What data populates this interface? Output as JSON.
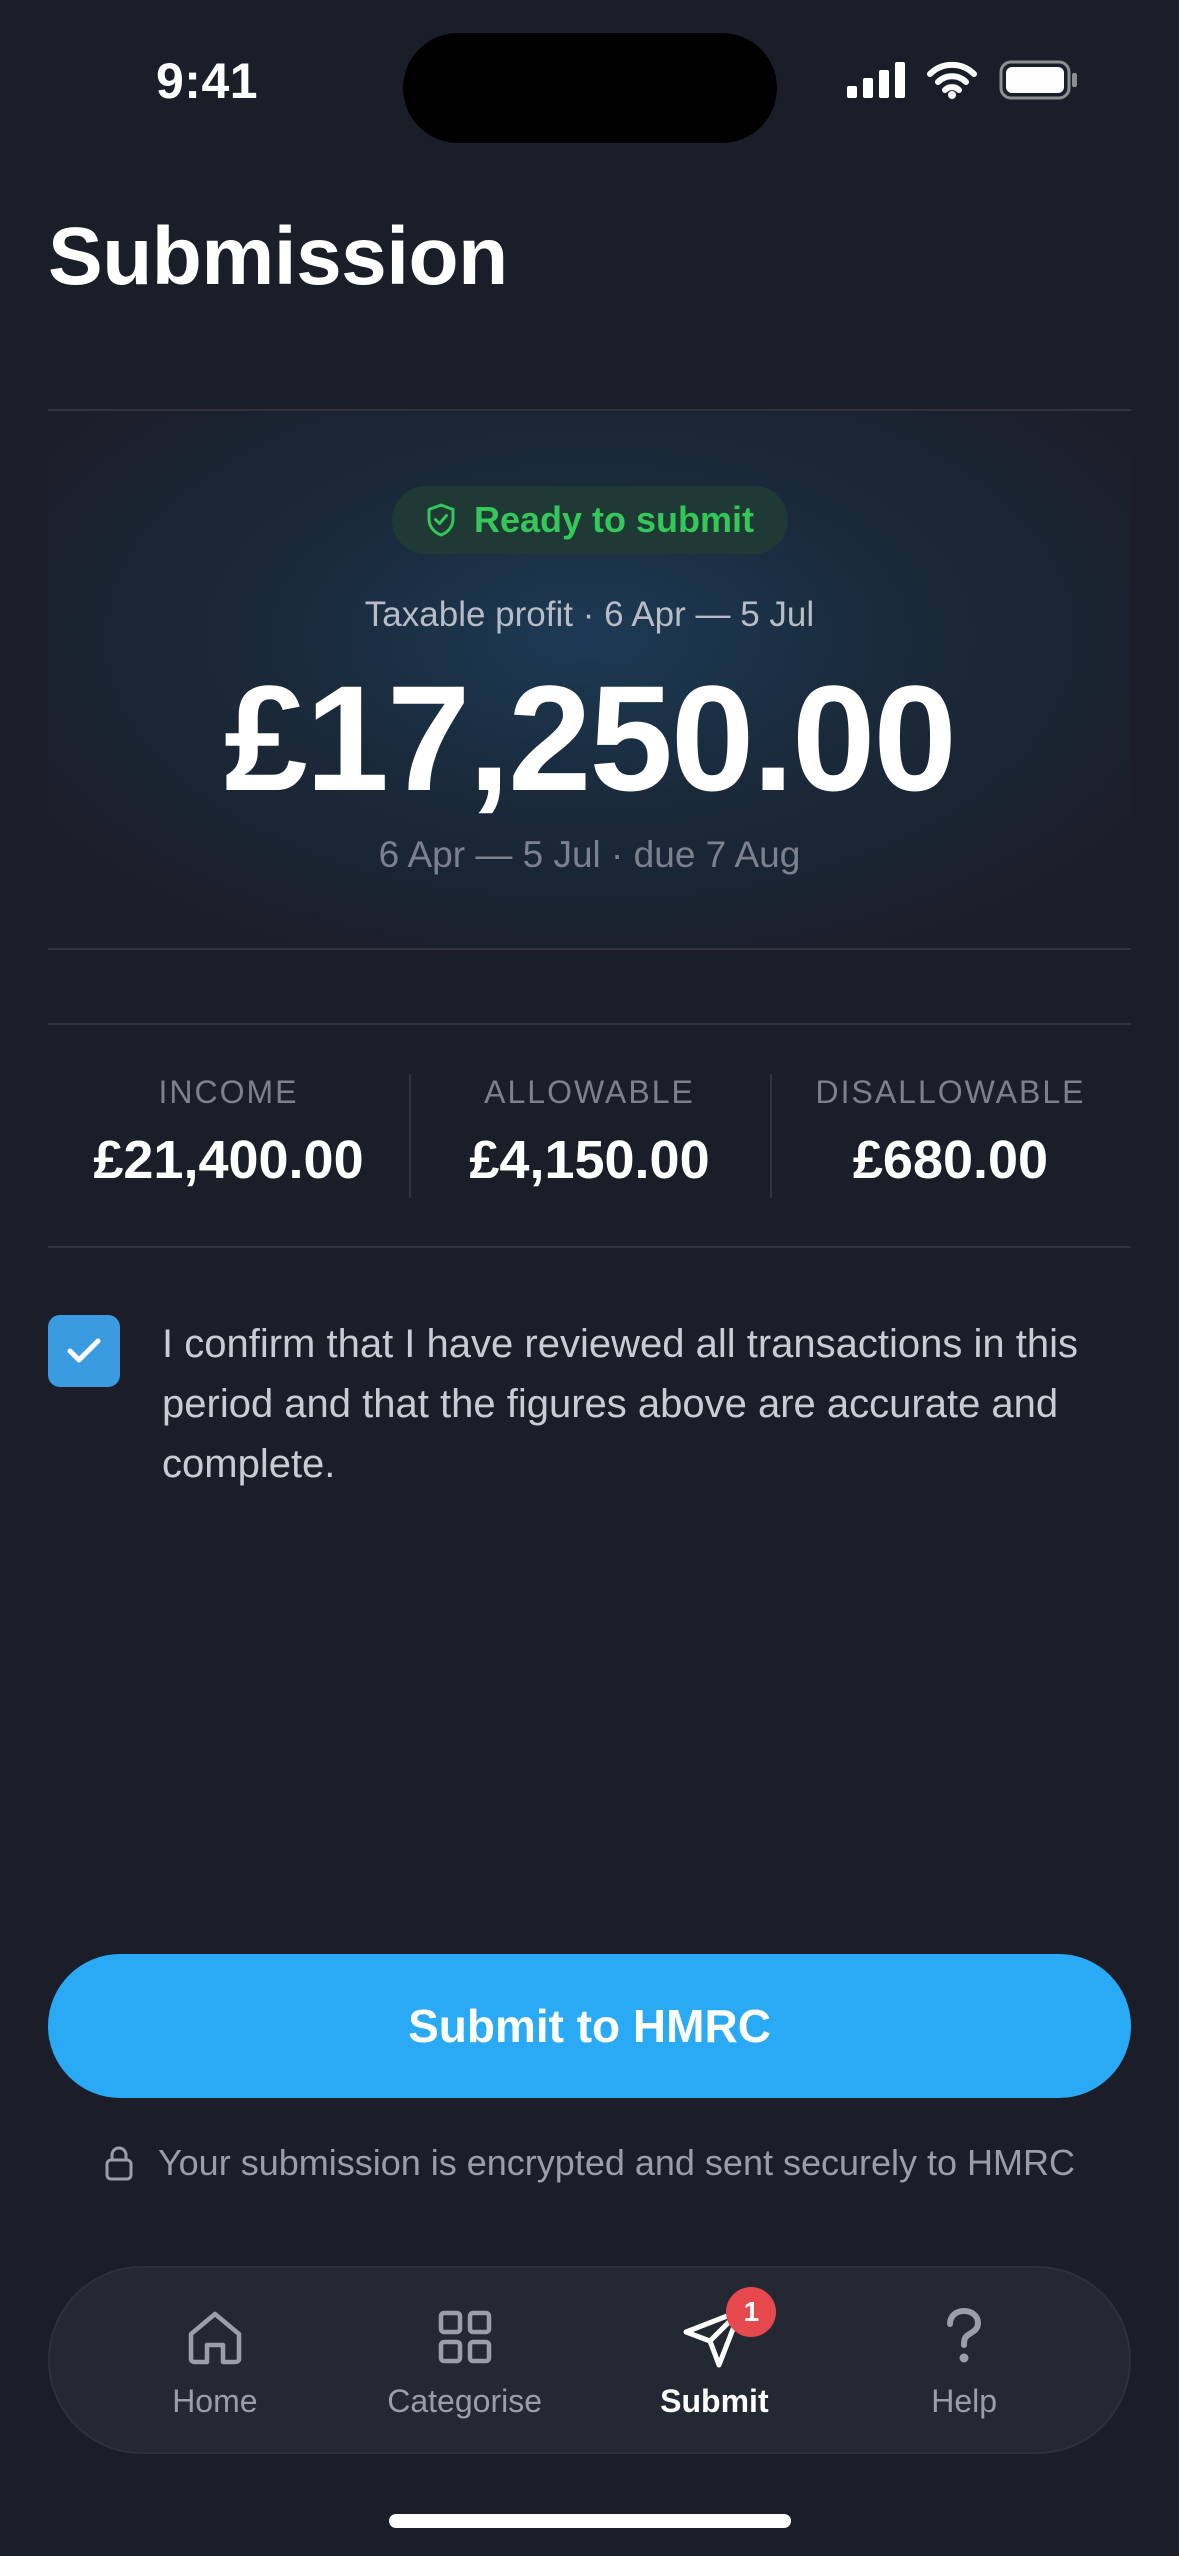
{
  "status_bar": {
    "time": "9:41",
    "icons": [
      "cellular-signal-icon",
      "wifi-icon",
      "battery-icon"
    ]
  },
  "header": {
    "title": "Submission"
  },
  "hero": {
    "badge_label": "Ready to submit",
    "badge_icon": "shield-check-icon",
    "subtitle": "Taxable profit · 6 Apr — 5 Jul",
    "amount": "£17,250.00",
    "period_due": "6 Apr — 5 Jul · due 7 Aug"
  },
  "stats": [
    {
      "label": "INCOME",
      "value": "£21,400.00"
    },
    {
      "label": "ALLOWABLE",
      "value": "£4,150.00"
    },
    {
      "label": "DISALLOWABLE",
      "value": "£680.00"
    }
  ],
  "confirmation": {
    "checked": true,
    "text": "I confirm that I have reviewed all transactions in this period and that the figures above are accurate and complete."
  },
  "submit": {
    "label": "Submit to HMRC",
    "secure_note": "Your submission is encrypted and sent securely to HMRC",
    "secure_icon": "lock-icon"
  },
  "tab_bar": {
    "items": [
      {
        "label": "Home",
        "icon": "home-icon",
        "active": false
      },
      {
        "label": "Categorise",
        "icon": "grid-icon",
        "active": false
      },
      {
        "label": "Submit",
        "icon": "send-icon",
        "active": true,
        "badge": "1"
      },
      {
        "label": "Help",
        "icon": "question-icon",
        "active": false
      }
    ]
  },
  "colors": {
    "background": "#1b1e28",
    "accent": "#2aaaf5",
    "success": "#34c759",
    "badge": "#e5484d",
    "checkbox": "#3b9be0"
  }
}
